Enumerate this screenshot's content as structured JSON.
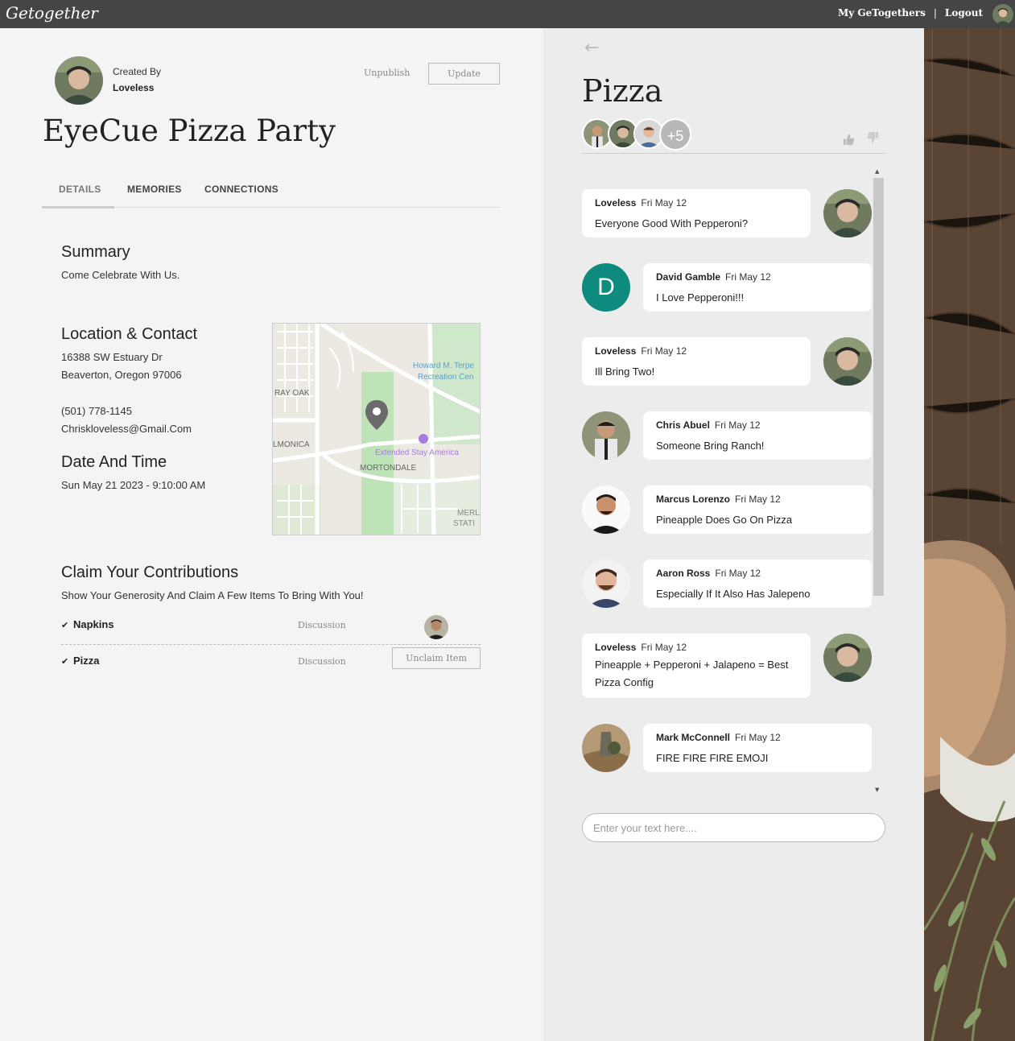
{
  "app": {
    "logo": "Getogether",
    "nav_my": "My GeTogethers",
    "nav_sep": "|",
    "nav_logout": "Logout"
  },
  "event": {
    "created_by_label": "Created By",
    "creator_name": "Loveless",
    "unpublish_label": "Unpublish",
    "update_label": "Update",
    "title": "EyeCue Pizza Party",
    "tabs": [
      "DETAILS",
      "MEMORIES",
      "CONNECTIONS"
    ],
    "summary_heading": "Summary",
    "summary_text": "Come Celebrate With Us.",
    "location_heading": "Location & Contact",
    "address_line1": "16388 SW Estuary Dr",
    "address_line2": "Beaverton, Oregon 97006",
    "phone": "(501) 778-1145",
    "email": "Chriskloveless@Gmail.Com",
    "datetime_heading": "Date And Time",
    "datetime_text": "Sun May 21 2023 - 9:10:00 AM",
    "map_labels": [
      "Howard M. Terpe",
      "Recreation Cen",
      "RAY OAK",
      "LMONICA",
      "Extended Stay America",
      "MORTONDALE",
      "MERL",
      "STATI"
    ],
    "contrib_heading": "Claim Your Contributions",
    "contrib_text": "Show Your Generosity And Claim A Few Items To Bring With You!",
    "contributions": [
      {
        "check": "✔",
        "name": "Napkins",
        "discussion": "Discussion"
      },
      {
        "check": "✔",
        "name": "Pizza",
        "discussion": "Discussion",
        "action": "Unclaim Item"
      }
    ]
  },
  "chat": {
    "back_icon": "arrow-left-icon",
    "title": "Pizza",
    "extra_participants": "+5",
    "messages": [
      {
        "author": "Loveless",
        "date": "Fri May 12",
        "text": "Everyone Good With Pepperoni?",
        "side": "right"
      },
      {
        "author": "David Gamble",
        "date": "Fri May 12",
        "text": "I Love Pepperoni!!!",
        "side": "left",
        "initial": "D"
      },
      {
        "author": "Loveless",
        "date": "Fri May 12",
        "text": "Ill Bring Two!",
        "side": "right"
      },
      {
        "author": "Chris Abuel",
        "date": "Fri May 12",
        "text": "Someone Bring Ranch!",
        "side": "left"
      },
      {
        "author": "Marcus Lorenzo",
        "date": "Fri May 12",
        "text": "Pineapple Does Go On Pizza",
        "side": "left"
      },
      {
        "author": "Aaron Ross",
        "date": "Fri May 12",
        "text": "Especially If It Also Has Jalepeno",
        "side": "left"
      },
      {
        "author": "Loveless",
        "date": "Fri May 12",
        "text": "Pineapple + Pepperoni + Jalapeno = Best Pizza Config",
        "side": "right"
      },
      {
        "author": "Mark McConnell",
        "date": "Fri May 12",
        "text": "FIRE FIRE FIRE EMOJI",
        "side": "left"
      }
    ],
    "input_placeholder": "Enter your text here...."
  },
  "colors": {
    "topbar": "#454545",
    "accent_teal": "#0f8a7e",
    "panel_bg": "#f4f4f4",
    "chat_bg": "#ececec"
  }
}
